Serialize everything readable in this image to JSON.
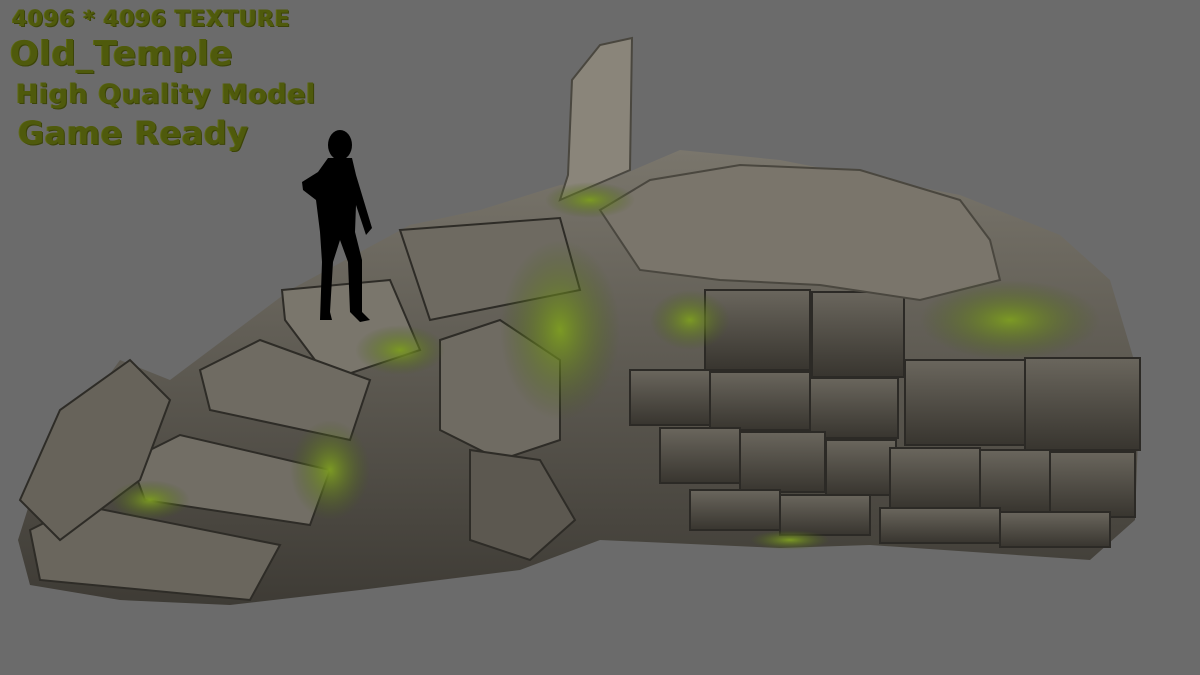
{
  "promo": {
    "line1": "4096 * 4096 TEXTURE",
    "line2": "Old_Temple",
    "line3": "High Quality Model",
    "line4": "Game Ready"
  },
  "colors": {
    "background": "#6b6b6b",
    "text": "#4f5a0c",
    "stone": "#5e5a52",
    "moss": "#5f7a1e",
    "silhouette": "#000000"
  },
  "icons": {
    "figure": "woman-silhouette-icon"
  }
}
